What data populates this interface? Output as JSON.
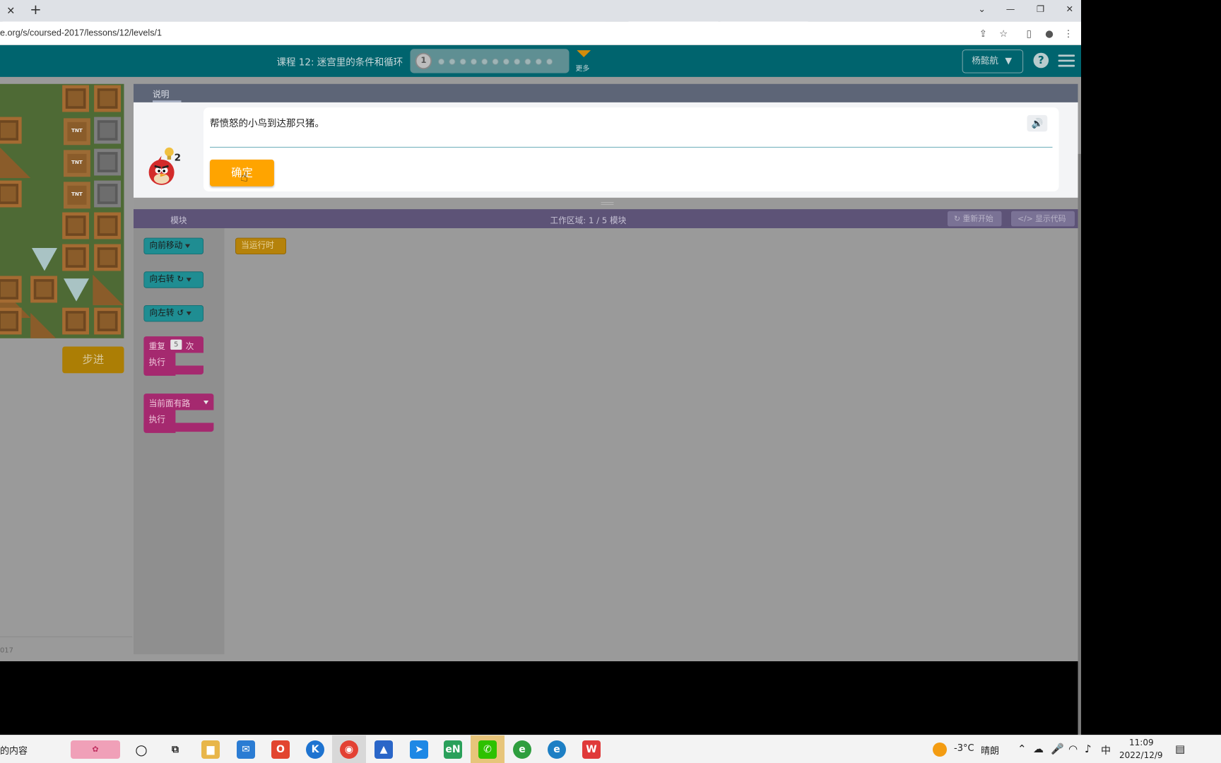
{
  "browser": {
    "tab_close": "✕",
    "new_tab": "+",
    "url": "e.org/s/coursed-2017/lessons/12/levels/1"
  },
  "header": {
    "lesson_title": "课程 12: 迷宫里的条件和循环",
    "current_level": "1",
    "more_label": "更多",
    "user_name": "杨懿航"
  },
  "instructions": {
    "tab_label": "说明",
    "hint_count": "2",
    "text": "帮愤怒的小鸟到达那只猪。",
    "ok_label": "确定"
  },
  "left_panel": {
    "step_label": "步进",
    "footer_text": "017"
  },
  "workspace": {
    "blocks_tab_label": "模块",
    "count_label": "工作区域: 1 / 5 模块",
    "restart_label": "重新开始",
    "show_code_label": "显示代码",
    "when_run_label": "当运行时"
  },
  "toolbox": {
    "move_forward": "向前移动",
    "turn_right": "向右转 ↻",
    "turn_left": "向左转 ↺",
    "repeat_label": "重复",
    "repeat_count": "5",
    "repeat_times": "次",
    "do_label": "执行",
    "if_path_label": "当前面有路",
    "if_do_label": "执行"
  },
  "taskbar": {
    "search_text": "的内容",
    "weather_temp": "-3°C",
    "weather_text": "晴朗",
    "ime": "中",
    "time": "11:09",
    "date": "2022/12/9"
  },
  "colors": {
    "header_bg": "#00646e",
    "ok_button": "#ffa400",
    "move_block": "#1f8d92",
    "loop_block": "#a5296f",
    "event_block": "#b5820a"
  }
}
